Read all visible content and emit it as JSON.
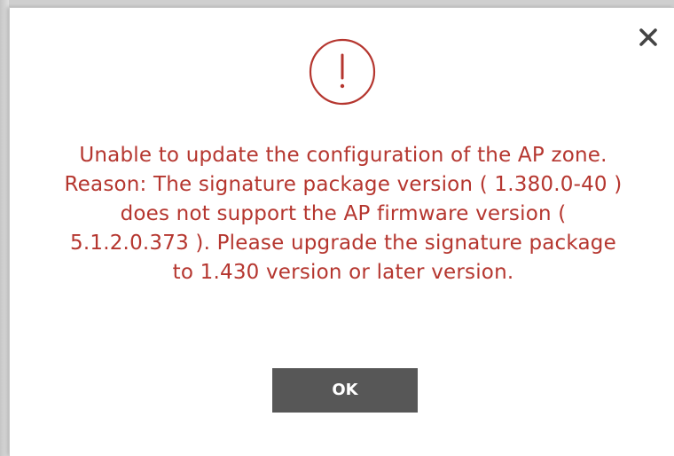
{
  "dialog": {
    "close_icon": "close-icon",
    "alert_icon": "exclamation-circle-icon",
    "alert_color": "#b5362f",
    "message_lines": [
      "Unable to update the configuration of the AP zone.",
      "Reason: The signature package version ( 1.380.0-40 )",
      "does not support the AP firmware version (",
      "5.1.2.0.373 ). Please upgrade the signature package",
      "to 1.430 version or later version."
    ],
    "ok_label": "OK",
    "ok_button_color": "#575757"
  }
}
